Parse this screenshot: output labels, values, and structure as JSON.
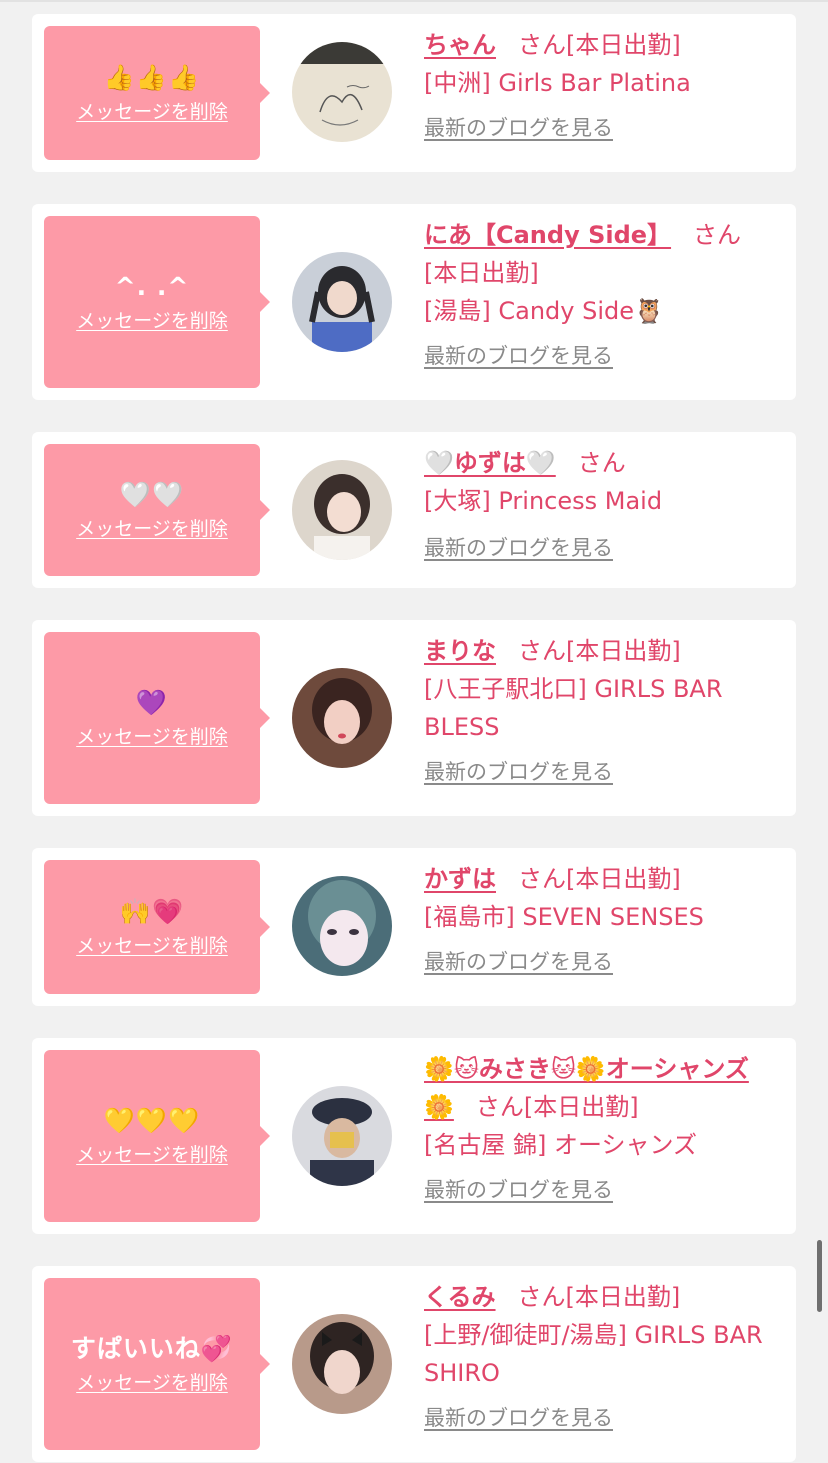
{
  "common": {
    "delete_label": "メッセージを削除",
    "blog_label": "最新のブログを見る",
    "san": "さん"
  },
  "cards": [
    {
      "message": "👍👍👍",
      "name": "ちゃん",
      "status": "さん[本日出勤]",
      "shop": "[中洲] Girls Bar Platina"
    },
    {
      "message": "^. .^",
      "name": "にあ【Candy Side】",
      "san": "さん",
      "status": "[本日出勤]",
      "shop": "[湯島] Candy Side🦉"
    },
    {
      "message": "🤍🤍",
      "name": "🤍ゆずは🤍",
      "san": "さん",
      "shop": "[大塚] Princess Maid"
    },
    {
      "message": "💜",
      "name": "まりな",
      "status": "さん[本日出勤]",
      "shop": "[八王子駅北口] GIRLS BAR BLESS"
    },
    {
      "message": "🙌💗",
      "name": "かずは",
      "status": "さん[本日出勤]",
      "shop": "[福島市] SEVEN SENSES"
    },
    {
      "message": "💛💛💛",
      "name": "🌼🐱みさき🐱🌼オーシャンズ🌼",
      "status": "さん[本日出勤]",
      "shop": "[名古屋 錦] オーシャンズ"
    },
    {
      "message": "すぱいいね💞",
      "name": "くるみ",
      "status": "さん[本日出勤]",
      "shop": "[上野/御徒町/湯島] GIRLS BAR SHIRO"
    }
  ],
  "colors": {
    "background": "#f1f1f1",
    "bubble": "#fd9aa7",
    "accent": "#e0466a",
    "link_gray": "#8a8a8a"
  }
}
